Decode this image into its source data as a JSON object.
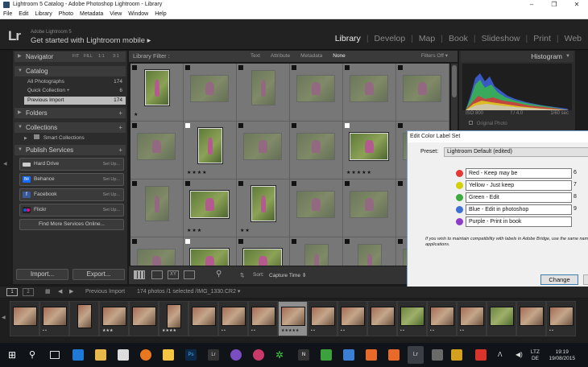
{
  "window": {
    "title": "Lightroom 5 Catalog - Adobe Photoshop Lightroom - Library"
  },
  "menu": [
    "File",
    "Edit",
    "Library",
    "Photo",
    "Metadata",
    "View",
    "Window",
    "Help"
  ],
  "identity": {
    "logo": "Lr",
    "sub": "Adobe Lightroom 5",
    "main": "Get started with Lightroom mobile ▸"
  },
  "modules": [
    {
      "label": "Library",
      "active": true
    },
    {
      "label": "Develop"
    },
    {
      "label": "Map"
    },
    {
      "label": "Book"
    },
    {
      "label": "Slideshow"
    },
    {
      "label": "Print"
    },
    {
      "label": "Web"
    }
  ],
  "navigator": {
    "title": "Navigator",
    "zoom": [
      "FIT",
      "FILL",
      "1:1",
      "3:1"
    ]
  },
  "catalog": {
    "title": "Catalog",
    "items": [
      {
        "label": "All Photographs",
        "count": "174"
      },
      {
        "label": "Quick Collection +",
        "count": "6"
      },
      {
        "label": "Previous Import",
        "count": "174",
        "selected": true
      }
    ]
  },
  "folders": {
    "title": "Folders"
  },
  "collections": {
    "title": "Collections",
    "items": [
      {
        "label": "Smart Collections"
      }
    ]
  },
  "publish": {
    "title": "Publish Services",
    "services": [
      {
        "label": "Hard Drive",
        "setup": "Set Up...",
        "color": "#cccccc"
      },
      {
        "label": "Behance",
        "setup": "Set Up...",
        "color": "#1769ff"
      },
      {
        "label": "Facebook",
        "setup": "Set Up...",
        "color": "#3b5998"
      },
      {
        "label": "Flickr",
        "setup": "Set Up...",
        "color": "#ff0084"
      }
    ],
    "find_more": "Find More Services Online..."
  },
  "buttons": {
    "import": "Import...",
    "export": "Export..."
  },
  "library_filter": {
    "label": "Library Filter :",
    "tabs": [
      "Text",
      "Attribute",
      "Metadata",
      "None"
    ],
    "active_tab": "None",
    "filters_off": "Filters Off ▾"
  },
  "grid": [
    {
      "flag": "black",
      "stars": "★",
      "dim": false
    },
    {
      "flag": "black",
      "stars": "",
      "dim": true
    },
    {
      "flag": "black",
      "stars": "",
      "dim": true
    },
    {
      "flag": "black",
      "stars": "",
      "dim": true
    },
    {
      "flag": "black",
      "stars": "",
      "dim": true
    },
    {
      "flag": "black",
      "stars": "",
      "dim": true
    },
    {
      "flag": "black",
      "stars": "",
      "dim": true
    },
    {
      "flag": "white",
      "stars": "★★★★",
      "dim": false
    },
    {
      "flag": "black",
      "stars": "",
      "dim": true
    },
    {
      "flag": "black",
      "stars": "",
      "dim": true
    },
    {
      "flag": "white",
      "stars": "★★★★★",
      "dim": false
    },
    {
      "flag": "black",
      "stars": "",
      "dim": true
    },
    {
      "flag": "black",
      "stars": "",
      "dim": true
    },
    {
      "flag": "black",
      "stars": "★★★",
      "dim": false
    },
    {
      "flag": "black",
      "stars": "★★",
      "dim": false
    },
    {
      "flag": "black",
      "stars": "",
      "dim": true
    },
    {
      "flag": "black",
      "stars": "",
      "dim": true
    },
    {
      "flag": "black",
      "stars": "",
      "dim": true
    },
    {
      "flag": "black",
      "stars": "",
      "dim": true
    },
    {
      "flag": "white",
      "stars": "",
      "dim": false
    },
    {
      "flag": "black",
      "stars": "",
      "dim": false
    },
    {
      "flag": "black",
      "stars": "",
      "dim": true
    },
    {
      "flag": "black",
      "stars": "",
      "dim": true
    },
    {
      "flag": "black",
      "stars": "",
      "dim": true
    }
  ],
  "toolbar": {
    "sort_label": "Sort:",
    "sort_value": "Capture Time ⇕"
  },
  "histogram": {
    "title": "Histogram",
    "iso": "ISO 800",
    "focal": "f / 4.0",
    "shutter": "1/60 sec",
    "original": "Original Photo"
  },
  "dialog": {
    "title": "Edit Color Label Set",
    "preset_label": "Preset:",
    "preset_value": "Lightroom Default (edited)",
    "labels": [
      {
        "color": "#e53935",
        "text": "Red - Keep may be",
        "key": "6"
      },
      {
        "color": "#d4d000",
        "text": "Yellow - Just keep",
        "key": "7"
      },
      {
        "color": "#3caa3c",
        "text": "Green - Edit",
        "key": "8"
      },
      {
        "color": "#3b6fd4",
        "text": "Blue - Edit in photoshop",
        "key": "9"
      },
      {
        "color": "#8e3cc8",
        "text": "Purple - Print in book",
        "key": ""
      }
    ],
    "compat_note": "If you wish to maintain compatibility with labels in Adobe Bridge, use the same nam applications.",
    "change_button": "Change"
  },
  "filmstrip_header": {
    "page1": "1",
    "page2": "2",
    "source": "Previous Import",
    "info": "174 photos /1 selected /IMG_1330.CR2 ▾"
  },
  "filmstrip": [
    {
      "stars": "",
      "green": false
    },
    {
      "stars": "• •",
      "green": false
    },
    {
      "stars": "",
      "green": false
    },
    {
      "stars": "★★★",
      "green": false
    },
    {
      "stars": "",
      "green": false
    },
    {
      "stars": "★★★★",
      "green": false
    },
    {
      "stars": "",
      "green": false
    },
    {
      "stars": "• •",
      "green": false
    },
    {
      "stars": "• •",
      "green": false
    },
    {
      "stars": "★★★★★",
      "green": false,
      "selected": true
    },
    {
      "stars": "• •",
      "green": false
    },
    {
      "stars": "• •",
      "green": false
    },
    {
      "stars": "",
      "green": false
    },
    {
      "stars": "• •",
      "green": true
    },
    {
      "stars": "• •",
      "green": false
    },
    {
      "stars": "• •",
      "green": false
    },
    {
      "stars": "",
      "green": true
    },
    {
      "stars": "",
      "green": false
    },
    {
      "stars": "• •",
      "green": false
    }
  ],
  "taskbar": {
    "lang_top": "LTZ",
    "lang_bottom": "DE",
    "time": "19:19",
    "date": "19/08/2015"
  }
}
